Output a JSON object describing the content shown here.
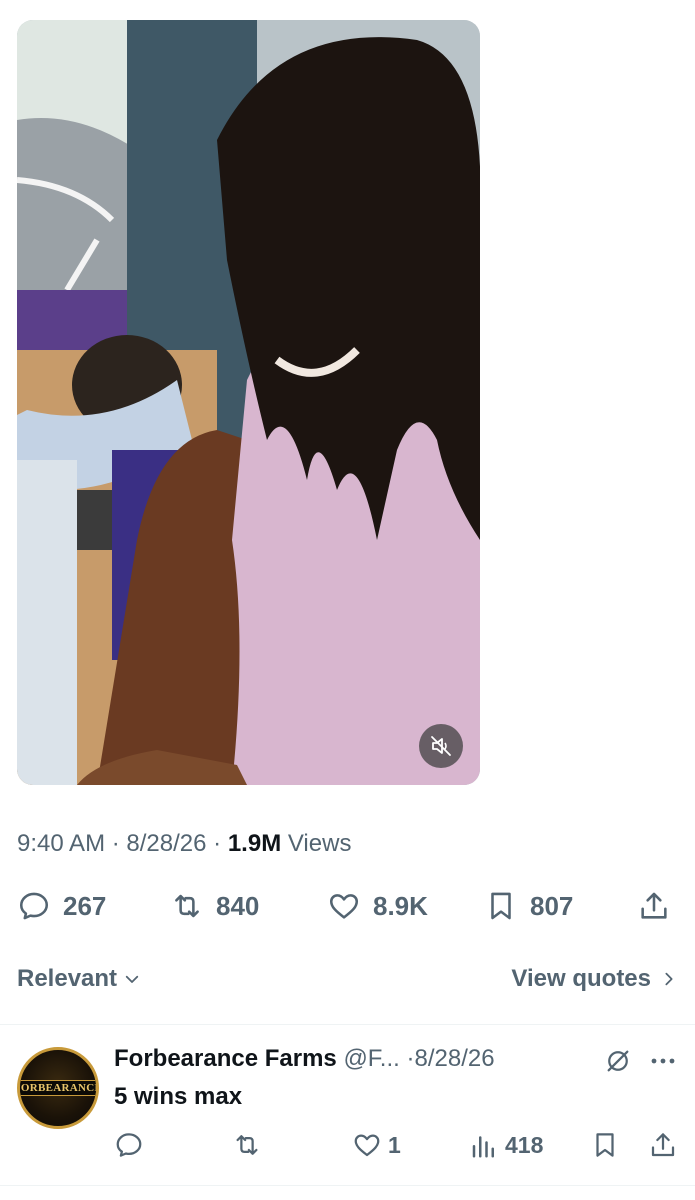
{
  "media": {
    "type": "video",
    "mute_icon": "speaker-muted-icon"
  },
  "meta": {
    "time": "9:40 AM",
    "date": "8/28/26",
    "views_count": "1.9M",
    "views_label": "Views",
    "separator": "·"
  },
  "actions": {
    "replies": "267",
    "reposts": "840",
    "likes": "8.9K",
    "bookmarks": "807"
  },
  "sort": {
    "label": "Relevant",
    "view_quotes": "View quotes"
  },
  "reply": {
    "name": "Forbearance Farms",
    "handle": "@F...",
    "date": "8/28/26",
    "text": "5 wins max",
    "avatar_text": "FORBEARANCE",
    "replies": "",
    "reposts": "",
    "likes": "1",
    "views": "418"
  },
  "colors": {
    "text_primary": "#0f1419",
    "text_secondary": "#536471",
    "divider": "#eff3f4",
    "avatar_gold": "#c89a3a"
  }
}
